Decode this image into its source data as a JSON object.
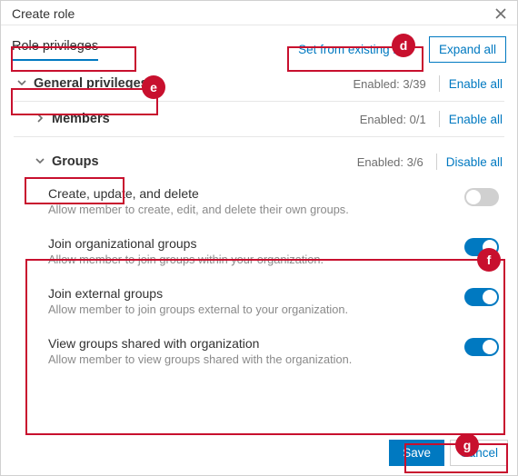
{
  "dialog": {
    "title": "Create role",
    "close_icon": "×"
  },
  "tabs": {
    "role_privileges": "Role privileges"
  },
  "actions": {
    "set_from_existing": "Set from existing role",
    "expand_all": "Expand all"
  },
  "sections": {
    "general": {
      "name": "General privileges",
      "enabled": "Enabled: 3/39",
      "action": "Enable all"
    },
    "members": {
      "name": "Members",
      "enabled": "Enabled: 0/1",
      "action": "Enable all"
    },
    "groups": {
      "name": "Groups",
      "enabled": "Enabled: 3/6",
      "action": "Disable all"
    }
  },
  "privileges": [
    {
      "title": "Create, update, and delete",
      "desc": "Allow member to create, edit, and delete their own groups.",
      "on": false
    },
    {
      "title": "Join organizational groups",
      "desc": "Allow member to join groups within your organization.",
      "on": true
    },
    {
      "title": "Join external groups",
      "desc": "Allow member to join groups external to your organization.",
      "on": true
    },
    {
      "title": "View groups shared with organization",
      "desc": "Allow member to view groups shared with the organization.",
      "on": true
    }
  ],
  "footer": {
    "save": "Save",
    "cancel": "Cancel"
  },
  "badges": {
    "d": "d",
    "e": "e",
    "f": "f",
    "g": "g"
  }
}
